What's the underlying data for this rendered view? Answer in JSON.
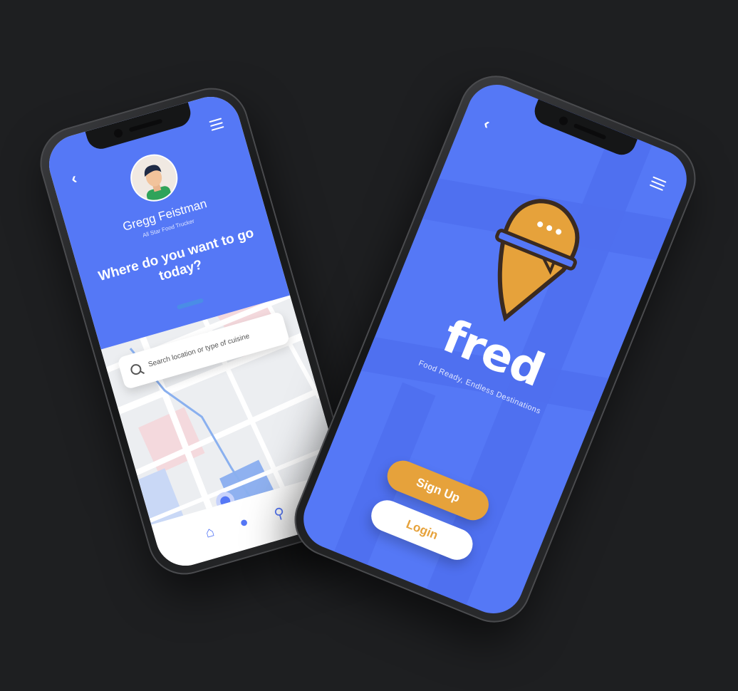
{
  "profile": {
    "name": "Gregg Feistman",
    "role": "All Star Food Trucker",
    "headline": "Where do you want to go today?"
  },
  "search": {
    "placeholder": "Search location or type of cuisine"
  },
  "nav": {
    "home": "home-icon",
    "profile": "user-icon",
    "location": "location-pin-icon"
  },
  "brand": {
    "name": "fred",
    "tagline": "Food Ready, Endless Destinations",
    "signup_label": "Sign Up",
    "login_label": "Login"
  },
  "colors": {
    "primary": "#5578f6",
    "accent": "#e6a23b",
    "background": "#1e1f21"
  }
}
